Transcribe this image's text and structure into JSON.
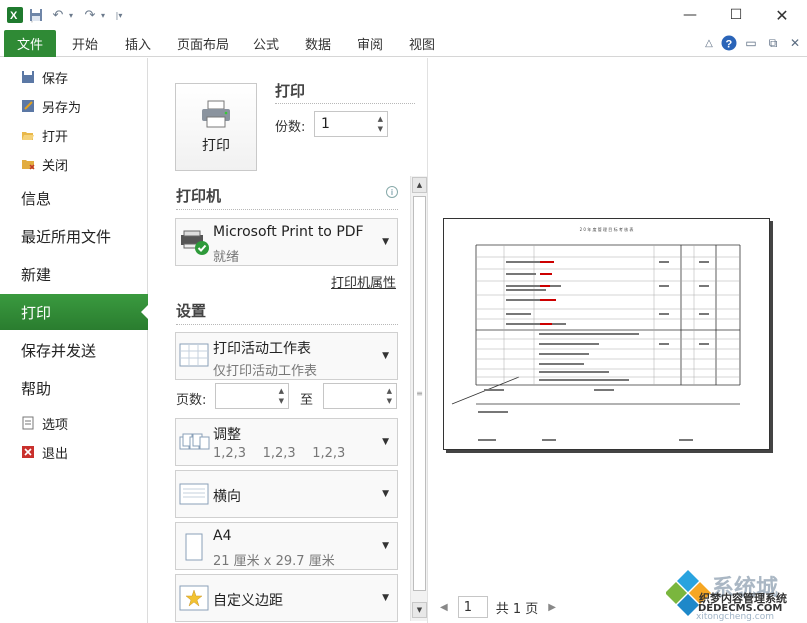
{
  "quick_access": {
    "app_icon": "excel-icon",
    "save": "save-icon",
    "undo": "undo-icon",
    "redo": "redo-icon",
    "customize": "customize-icon"
  },
  "ribbon": {
    "file_tab": "文件",
    "tabs": [
      "开始",
      "插入",
      "页面布局",
      "公式",
      "数据",
      "审阅",
      "视图"
    ]
  },
  "nav": {
    "save": "保存",
    "save_as": "另存为",
    "open": "打开",
    "close": "关闭",
    "info": "信息",
    "recent": "最近所用文件",
    "new": "新建",
    "print": "打印",
    "save_send": "保存并发送",
    "help": "帮助",
    "options": "选项",
    "exit": "退出"
  },
  "print_panel": {
    "print_button": "打印",
    "print_heading": "打印",
    "copies_label": "份数:",
    "copies_value": "1",
    "printer_heading": "打印机",
    "printer_name": "Microsoft Print to PDF",
    "printer_status": "就绪",
    "printer_properties": "打印机属性",
    "settings_heading": "设置",
    "scope_title": "打印活动工作表",
    "scope_sub": "仅打印活动工作表",
    "pages_label": "页数:",
    "pages_to": "至",
    "collate_title": "调整",
    "collate_sub": "1,2,3    1,2,3    1,2,3",
    "orientation": "横向",
    "paper_title": "A4",
    "paper_sub": "21 厘米 x 29.7 厘米",
    "margins": "自定义边距"
  },
  "preview": {
    "page_value": "1",
    "page_total": "共 1 页",
    "doc_title": "2 0 年 度 管 理 目 标 考 核 表"
  },
  "watermark": {
    "text1": "系统城",
    "text2": "织梦内容管理系统",
    "text3": "DEDECMS.COM",
    "text4": "xitongcheng.com"
  },
  "colors": {
    "accent": "#2f8a35",
    "accent_dark": "#2a7d2f",
    "red_sample": "#cc0000"
  }
}
